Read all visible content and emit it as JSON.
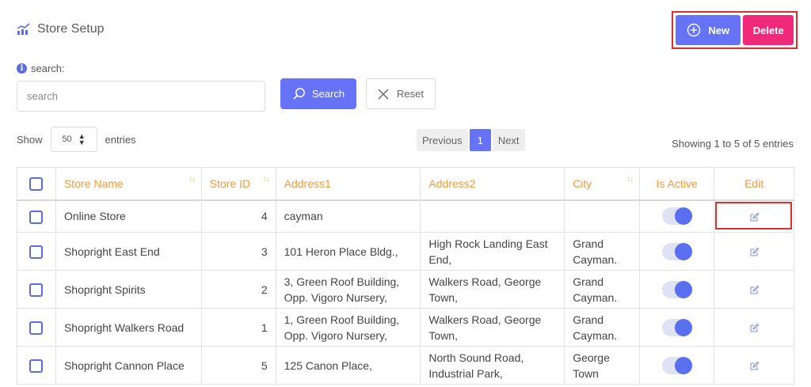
{
  "page": {
    "title": "Store Setup"
  },
  "actions": {
    "new_label": "New",
    "delete_label": "Delete"
  },
  "search": {
    "label": "search:",
    "placeholder": "search",
    "value": "",
    "search_button": "Search",
    "reset_button": "Reset"
  },
  "length": {
    "show_label": "Show",
    "selected": "50",
    "entries_label": "entries"
  },
  "pagination": {
    "previous": "Previous",
    "current": "1",
    "next": "Next"
  },
  "info": "Showing 1 to 5 of 5 entries",
  "table": {
    "columns": [
      "Store Name",
      "Store ID",
      "Address1",
      "Address2",
      "City",
      "Is Active",
      "Edit"
    ],
    "rows": [
      {
        "name": "Online Store",
        "id": "4",
        "address1": "cayman",
        "address2": "",
        "city": "",
        "active": true
      },
      {
        "name": "Shopright East End",
        "id": "3",
        "address1": "101 Heron Place Bldg.,",
        "address2": "High Rock Landing East End,",
        "city": "Grand Cayman.",
        "active": true
      },
      {
        "name": "Shopright Spirits",
        "id": "2",
        "address1": "3, Green Roof Building, Opp. Vigoro Nursery,",
        "address2": "Walkers Road, George Town,",
        "city": "Grand Cayman.",
        "active": true
      },
      {
        "name": "Shopright Walkers Road",
        "id": "1",
        "address1": "1, Green Roof Building, Opp. Vigoro Nursery,",
        "address2": "Walkers Road, George Town,",
        "city": "Grand Cayman.",
        "active": true
      },
      {
        "name": "Shopright Cannon Place",
        "id": "5",
        "address1": "125 Canon Place,",
        "address2": "North Sound Road, Industrial Park,",
        "city": "George Town",
        "active": true
      }
    ]
  },
  "colors": {
    "primary": "#6673f7",
    "danger": "#f0297a",
    "header_text": "#f39a3e",
    "highlight": "#d9302c"
  },
  "icons": {
    "title": "chart-icon",
    "new": "plus-circle-icon",
    "search": "search-icon",
    "reset": "close-icon",
    "edit": "edit-icon",
    "info": "info-icon"
  }
}
